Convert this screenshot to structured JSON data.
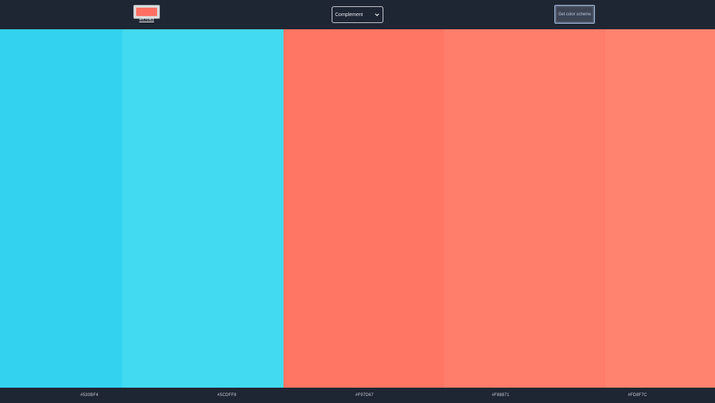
{
  "header": {
    "seed_color": {
      "hex_label": "#ff7063",
      "color": "#ff7063"
    },
    "mode_select": {
      "selected": "Complement"
    },
    "scheme_button": {
      "label": "Get color scheme"
    }
  },
  "palette": {
    "colors": [
      {
        "hex": "#33D3F0",
        "label": "#530BF4"
      },
      {
        "hex": "#42DAF0",
        "label": "#5CDFF8"
      },
      {
        "hex": "#FF7664",
        "label": "#F97D67"
      },
      {
        "hex": "#FF7D6B",
        "label": "#F88871"
      },
      {
        "hex": "#FF836F",
        "label": "#FD8F7C"
      }
    ]
  },
  "footer": {
    "labels": [
      "#530BF4",
      "#5CDFF8",
      "#F97D67",
      "#F88871",
      "#FD8F7C"
    ]
  }
}
